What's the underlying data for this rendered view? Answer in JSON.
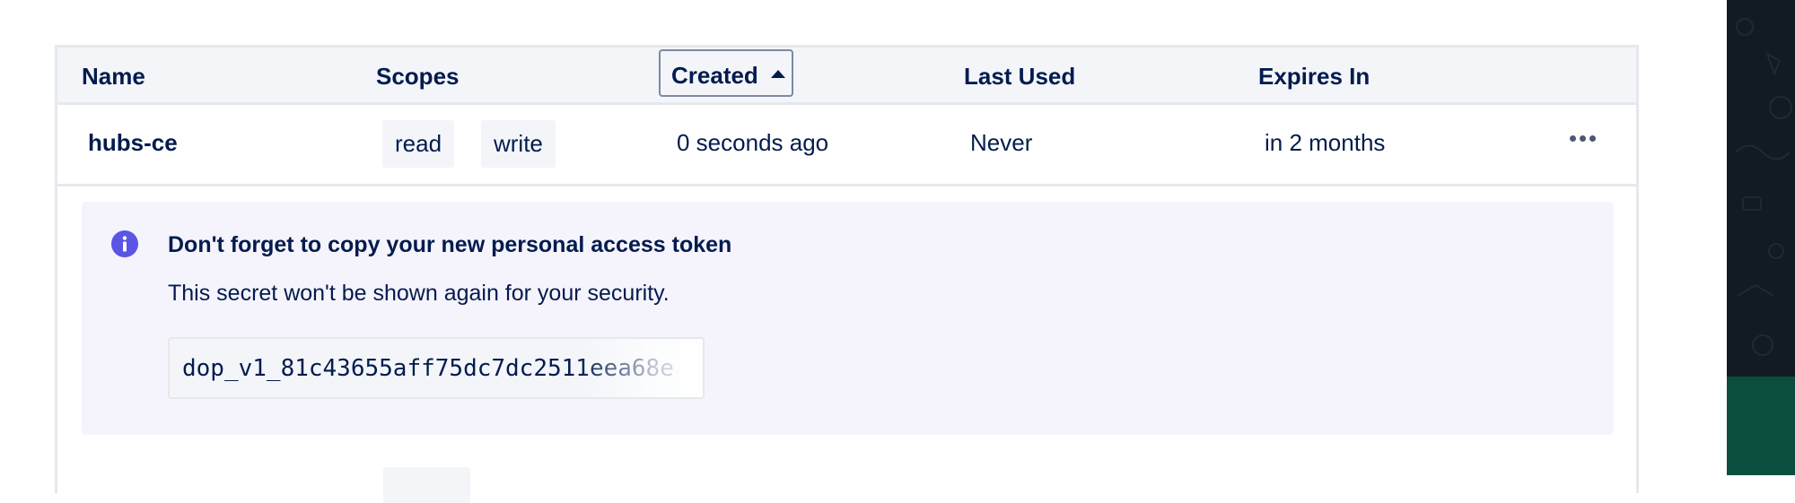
{
  "table": {
    "columns": {
      "name": "Name",
      "scopes": "Scopes",
      "created": "Created",
      "last_used": "Last Used",
      "expires_in": "Expires In"
    },
    "sort": {
      "column": "Created",
      "direction": "ascending",
      "icon": "caret-up-icon"
    },
    "rows": [
      {
        "name": "hubs-ce",
        "scopes": [
          "read",
          "write"
        ],
        "created": "0 seconds ago",
        "last_used": "Never",
        "expires_in": "in 2 months",
        "actions_icon": "more-horizontal-icon"
      }
    ]
  },
  "notice": {
    "icon": "info-icon",
    "title": "Don't forget to copy your new personal access token",
    "body": "This secret won't be shown again for your security.",
    "token": "dop_v1_81c43655aff75dc7dc2511eea68e",
    "copy_icon": "copy-icon"
  },
  "colors": {
    "text": "#031b4e",
    "header_bg": "#f3f5f9",
    "border": "#e5e8ed",
    "notice_bg": "#f5f4fc",
    "info_accent": "#5b55e6",
    "link": "#0069ff",
    "side_panel_dark": "#121b22",
    "side_panel_green": "#0b4e3e"
  }
}
